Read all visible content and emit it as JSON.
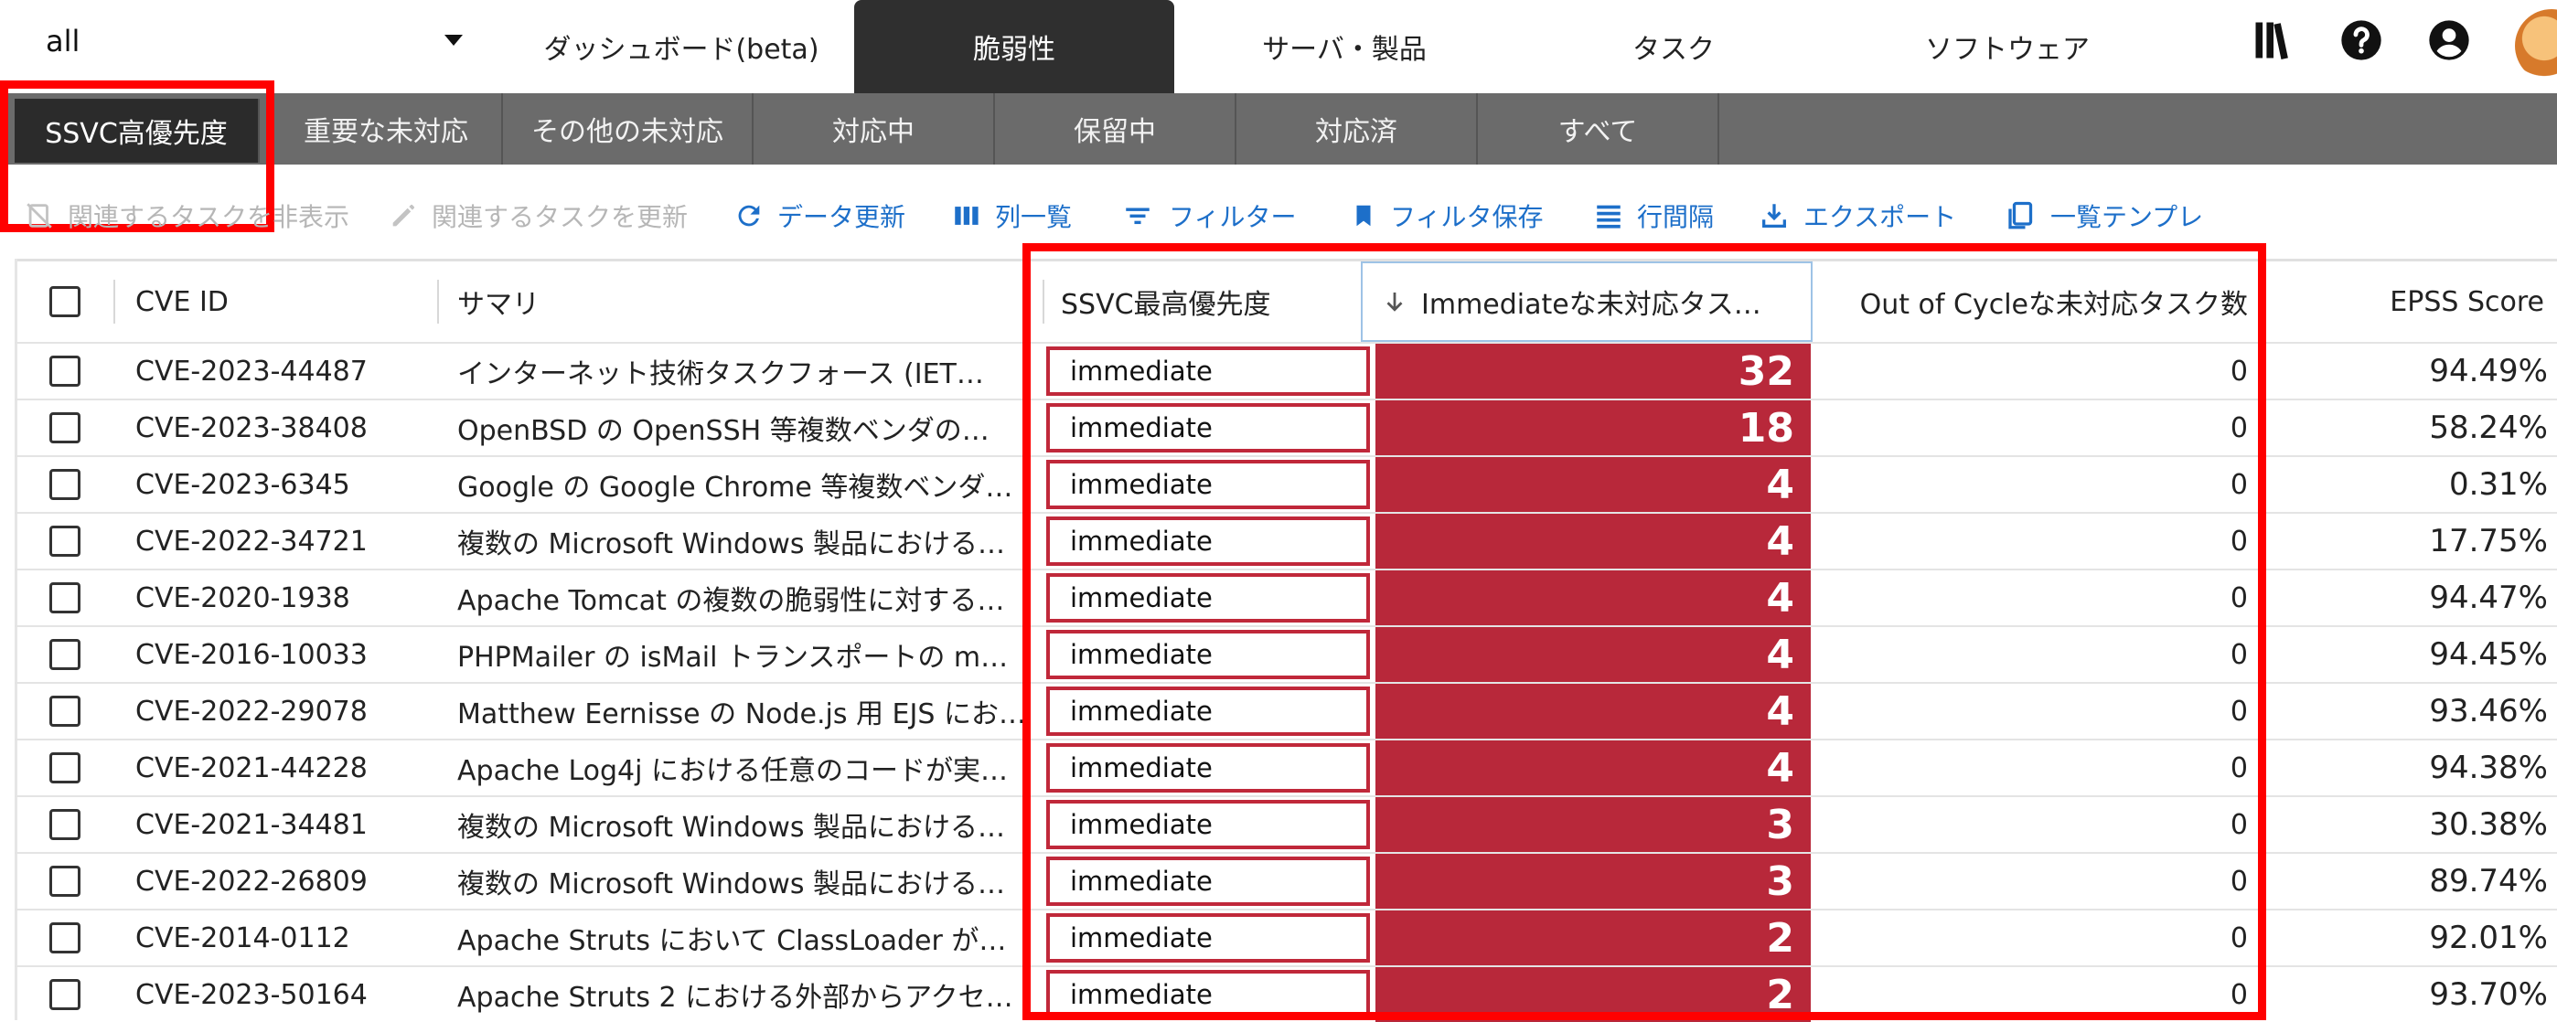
{
  "topbar": {
    "selector_value": "all",
    "tabs": [
      {
        "label": "ダッシュボード(beta)"
      },
      {
        "label": "脆弱性"
      },
      {
        "label": "サーバ・製品"
      },
      {
        "label": "タスク"
      },
      {
        "label": "ソフトウェア"
      }
    ],
    "active_tab": "脆弱性"
  },
  "subtabs": [
    {
      "label": "SSVC高優先度"
    },
    {
      "label": "重要な未対応"
    },
    {
      "label": "その他の未対応"
    },
    {
      "label": "対応中"
    },
    {
      "label": "保留中"
    },
    {
      "label": "対応済"
    },
    {
      "label": "すべて"
    }
  ],
  "toolbar": {
    "hide_tasks": "関連するタスクを非表示",
    "update_tasks": "関連するタスクを更新",
    "refresh": "データ更新",
    "columns": "列一覧",
    "filter": "フィルター",
    "save_filter": "フィルタ保存",
    "density": "行間隔",
    "export": "エクスポート",
    "template": "一覧テンプレ"
  },
  "table": {
    "columns": [
      "CVE ID",
      "サマリ",
      "SSVC最高優先度",
      "Immediateな未対応タス…",
      "Out of Cycleな未対応タスク数",
      "EPSS Score"
    ],
    "rows": [
      {
        "cve": "CVE-2023-44487",
        "summary": "インターネット技術タスクフォース (IET…",
        "ssvc": "immediate",
        "immediate": "32",
        "ooc": "0",
        "epss": "94.49%"
      },
      {
        "cve": "CVE-2023-38408",
        "summary": "OpenBSD の OpenSSH 等複数ベンダの…",
        "ssvc": "immediate",
        "immediate": "18",
        "ooc": "0",
        "epss": "58.24%"
      },
      {
        "cve": "CVE-2023-6345",
        "summary": "Google の Google Chrome 等複数ベンダ…",
        "ssvc": "immediate",
        "immediate": "4",
        "ooc": "0",
        "epss": "0.31%"
      },
      {
        "cve": "CVE-2022-34721",
        "summary": "複数の Microsoft Windows 製品における…",
        "ssvc": "immediate",
        "immediate": "4",
        "ooc": "0",
        "epss": "17.75%"
      },
      {
        "cve": "CVE-2020-1938",
        "summary": "Apache Tomcat の複数の脆弱性に対する…",
        "ssvc": "immediate",
        "immediate": "4",
        "ooc": "0",
        "epss": "94.47%"
      },
      {
        "cve": "CVE-2016-10033",
        "summary": "PHPMailer の isMail トランスポートの m…",
        "ssvc": "immediate",
        "immediate": "4",
        "ooc": "0",
        "epss": "94.45%"
      },
      {
        "cve": "CVE-2022-29078",
        "summary": "Matthew Eernisse の Node.js 用 EJS にお…",
        "ssvc": "immediate",
        "immediate": "4",
        "ooc": "0",
        "epss": "93.46%"
      },
      {
        "cve": "CVE-2021-44228",
        "summary": "Apache Log4j における任意のコードが実…",
        "ssvc": "immediate",
        "immediate": "4",
        "ooc": "0",
        "epss": "94.38%"
      },
      {
        "cve": "CVE-2021-34481",
        "summary": "複数の Microsoft Windows 製品における…",
        "ssvc": "immediate",
        "immediate": "3",
        "ooc": "0",
        "epss": "30.38%"
      },
      {
        "cve": "CVE-2022-26809",
        "summary": "複数の Microsoft Windows 製品における…",
        "ssvc": "immediate",
        "immediate": "3",
        "ooc": "0",
        "epss": "89.74%"
      },
      {
        "cve": "CVE-2014-0112",
        "summary": "Apache Struts において ClassLoader が…",
        "ssvc": "immediate",
        "immediate": "2",
        "ooc": "0",
        "epss": "92.01%"
      },
      {
        "cve": "CVE-2023-50164",
        "summary": "Apache Struts 2 における外部からアクセ…",
        "ssvc": "immediate",
        "immediate": "2",
        "ooc": "0",
        "epss": "93.70%"
      }
    ]
  },
  "colors": {
    "accent_blue": "#1d6fc9",
    "immediate_red": "#b8283a",
    "highlight_red": "#ff0000",
    "subbar_gray": "#6b6b6b",
    "active_dark": "#2f2f2f"
  }
}
